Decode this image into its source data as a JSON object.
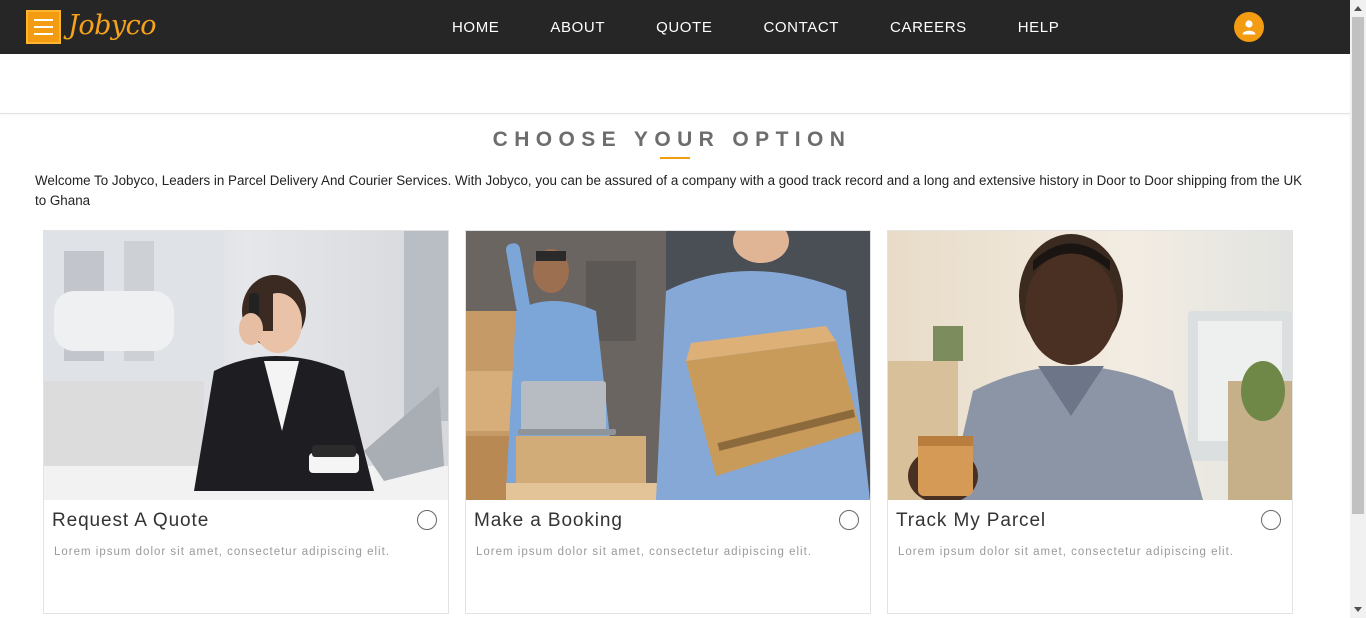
{
  "header": {
    "brand": "Jobyco",
    "nav": [
      "HOME",
      "ABOUT",
      "QUOTE",
      "CONTACT",
      "CAREERS",
      "HELP"
    ]
  },
  "main": {
    "section_title": "CHOOSE YOUR OPTION",
    "intro": "Welcome To Jobyco, Leaders in Parcel Delivery And Courier Services. With Jobyco, you can be assured of a company with a good track record and a long and extensive history in Door to Door shipping from the UK to Ghana",
    "cards": [
      {
        "title": "Request A Quote",
        "description": "Lorem ipsum dolor sit amet, consectetur adipiscing elit.",
        "image": "woman-on-phone-with-laptop"
      },
      {
        "title": "Make a Booking",
        "description": "Lorem ipsum dolor sit amet, consectetur adipiscing elit.",
        "image": "warehouse-workers-with-boxes"
      },
      {
        "title": "Track My Parcel",
        "description": "Lorem ipsum dolor sit amet, consectetur adipiscing elit.",
        "image": "man-with-coffee-cup"
      }
    ]
  },
  "icons": {
    "menu": "hamburger-icon",
    "user": "user-icon",
    "scroll_up": "arrow-up-icon",
    "scroll_down": "arrow-down-icon"
  },
  "colors": {
    "nav_bg": "#262626",
    "accent": "#f39c12",
    "title_text": "#6d6d6d",
    "body_text": "#222222",
    "muted_text": "#9a9a9a"
  }
}
